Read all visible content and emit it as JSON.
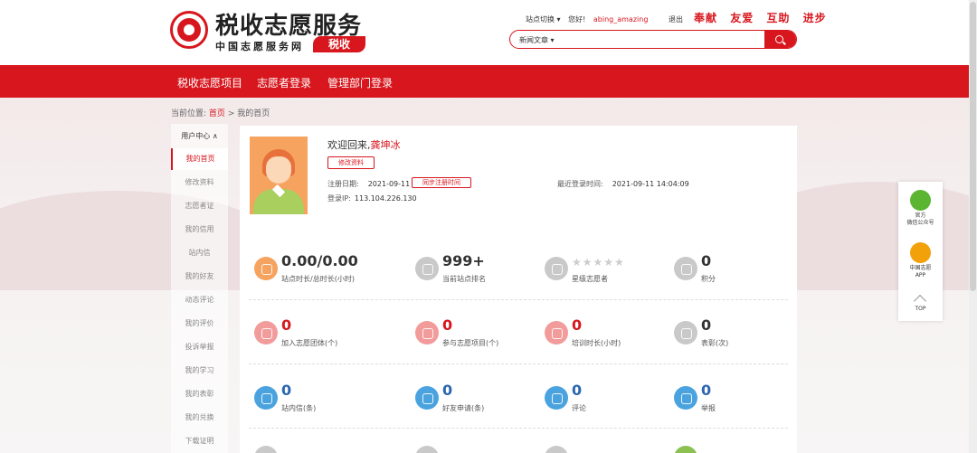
{
  "header": {
    "title": "税收志愿服务",
    "subtitle": "中国志愿服务网",
    "tag": "税收",
    "site_switch": "站点切换 ▾",
    "greeting": "您好!",
    "username": "abing_amazing",
    "logout": "退出",
    "slogans": [
      "奉献",
      "友爱",
      "互助",
      "进步"
    ],
    "search_select": "新闻文章 ▾",
    "search_placeholder": ""
  },
  "nav": {
    "items": [
      "税收志愿项目",
      "志愿者登录",
      "管理部门登录"
    ]
  },
  "breadcrumb": {
    "prefix": "当前位置:",
    "home": "首页",
    "sep": ">",
    "current": "我的首页"
  },
  "sidebar": {
    "head": "用户中心 ∧",
    "items": [
      "我的首页",
      "修改资料",
      "志愿者证",
      "我的信用",
      "站内信",
      "我的好友",
      "动态评论",
      "我的评价",
      "投诉举报",
      "我的学习",
      "我的表彰",
      "我的兑换",
      "下载证明"
    ]
  },
  "profile": {
    "welcome": "欢迎回来,",
    "name": "龚坤冰",
    "edit_btn": "修改资料",
    "reg_label": "注册日期:",
    "reg_date": "2021-09-11",
    "sync_btn": "同步注册时间",
    "last_login_label": "最近登录时间:",
    "last_login": "2021-09-11 14:04:09",
    "ip_label": "登录IP:",
    "ip": "113.104.226.130"
  },
  "stats": {
    "row1": [
      {
        "num": "0.00/0.00",
        "label": "站点时长/总时长(小时)",
        "color": "#f5a35f"
      },
      {
        "num": "999+",
        "label": "当前站点排名",
        "color": "#c9c9c9"
      },
      {
        "num": "",
        "label": "星级志愿者",
        "color": "#c9c9c9",
        "stars": "★★★★★"
      },
      {
        "num": "0",
        "label": "积分",
        "color": "#c9c9c9"
      }
    ],
    "row2": [
      {
        "num": "0",
        "label": "加入志愿团体(个)",
        "color": "#f29b9b"
      },
      {
        "num": "0",
        "label": "参与志愿项目(个)",
        "color": "#f29b9b"
      },
      {
        "num": "0",
        "label": "培训时长(小时)",
        "color": "#f29b9b"
      },
      {
        "num": "0",
        "label": "表彰(次)",
        "color": "#c9c9c9"
      }
    ],
    "row3": [
      {
        "num": "0",
        "label": "站内信(条)",
        "color": "#4aa3df"
      },
      {
        "num": "0",
        "label": "好友申请(条)",
        "color": "#4aa3df"
      },
      {
        "num": "0",
        "label": "评论",
        "color": "#4aa3df"
      },
      {
        "num": "0",
        "label": "举报",
        "color": "#4aa3df"
      }
    ]
  },
  "float": {
    "wechat": "官方\n微信公众号",
    "app": "中国志愿\nAPP",
    "top": "TOP"
  },
  "colors": {
    "brand": "#d7161d",
    "num_red": "#d7161d",
    "num_blue": "#2b66b1",
    "num_dark": "#333333"
  }
}
